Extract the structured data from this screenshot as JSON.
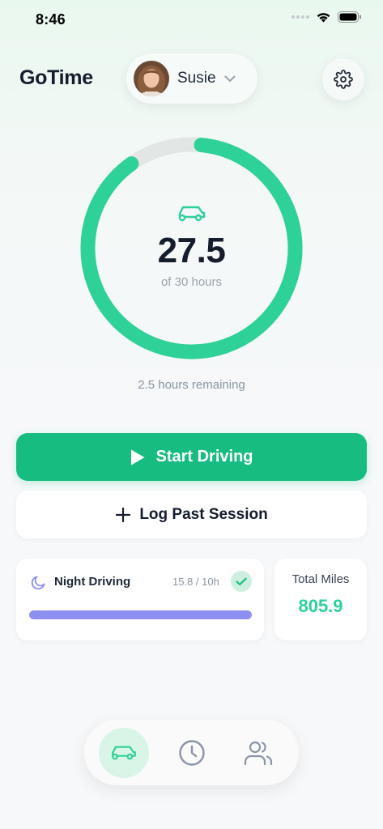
{
  "status_bar": {
    "time": "8:46"
  },
  "header": {
    "app_title": "GoTime",
    "profile_name": "Susie"
  },
  "progress": {
    "current_hours": "27.5",
    "total_label": "of 30 hours",
    "fraction": 0.9167,
    "remaining_label": "2.5 hours remaining"
  },
  "actions": {
    "start_label": "Start Driving",
    "log_label": "Log Past Session"
  },
  "night_card": {
    "title": "Night Driving",
    "progress_text": "15.8 / 10h",
    "fraction": 1.0
  },
  "miles_card": {
    "label": "Total Miles",
    "value": "805.9"
  },
  "tabs": [
    {
      "icon": "car-icon",
      "active": true
    },
    {
      "icon": "clock-icon",
      "active": false
    },
    {
      "icon": "people-icon",
      "active": false
    }
  ],
  "colors": {
    "accent": "#2ED197",
    "button": "#17BD80",
    "night_bar": "#8C8FF0",
    "ring_track": "#E2E6E4"
  }
}
